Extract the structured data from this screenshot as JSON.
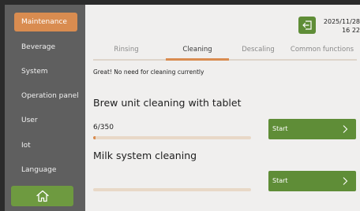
{
  "sidebar": {
    "items": [
      {
        "label": "Maintenance",
        "active": true
      },
      {
        "label": "Beverage",
        "active": false
      },
      {
        "label": "System",
        "active": false
      },
      {
        "label": "Operation panel",
        "active": false
      },
      {
        "label": "User",
        "active": false
      },
      {
        "label": "Iot",
        "active": false
      },
      {
        "label": "Language",
        "active": false
      }
    ],
    "home_icon": "home-icon"
  },
  "header": {
    "date": "2025/11/28",
    "time": "16 22",
    "exit_icon": "exit-icon"
  },
  "tabs": [
    {
      "label": "Rinsing",
      "active": false
    },
    {
      "label": "Cleaning",
      "active": true
    },
    {
      "label": "Descaling",
      "active": false
    },
    {
      "label": "Common functions",
      "active": false
    }
  ],
  "main": {
    "status_message": "Great! No need for cleaning currently",
    "brew_unit": {
      "title": "Brew unit cleaning with tablet",
      "counter": "6/350",
      "progress": 0.017,
      "start_label": "Start"
    },
    "milk_system": {
      "title": "Milk system cleaning",
      "progress": 0,
      "start_label": "Start"
    }
  },
  "colors": {
    "accent_orange": "#d98c50",
    "accent_green": "#5f8d37",
    "sidebar_bg": "#5f5f5f",
    "main_bg": "#f0efee"
  }
}
